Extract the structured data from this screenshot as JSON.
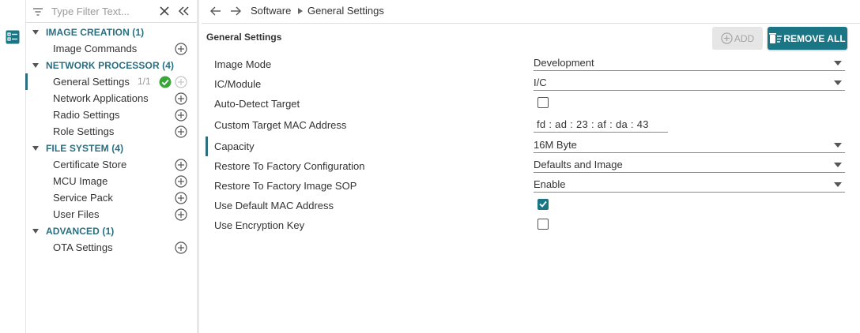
{
  "filter": {
    "placeholder": "Type Filter Text..."
  },
  "tree": {
    "categories": [
      {
        "label": "IMAGE CREATION (1)"
      },
      {
        "label": "NETWORK PROCESSOR (4)"
      },
      {
        "label": "FILE SYSTEM (4)"
      },
      {
        "label": "ADVANCED (1)"
      }
    ],
    "items": [
      {
        "label": "Image Commands"
      },
      {
        "label": "General Settings",
        "count": "1/1"
      },
      {
        "label": "Network Applications"
      },
      {
        "label": "Radio Settings"
      },
      {
        "label": "Role Settings"
      },
      {
        "label": "Certificate Store"
      },
      {
        "label": "MCU Image"
      },
      {
        "label": "Service Pack"
      },
      {
        "label": "User Files"
      },
      {
        "label": "OTA Settings"
      }
    ]
  },
  "breadcrumb": {
    "items": [
      "Software",
      "General Settings"
    ]
  },
  "main": {
    "title": "General Settings",
    "add_label": "ADD",
    "remove_all_label": "REMOVE ALL"
  },
  "properties": [
    {
      "label": "Image Mode",
      "type": "select",
      "value": "Development"
    },
    {
      "label": "IC/Module",
      "type": "select",
      "value": "I/C"
    },
    {
      "label": "Auto-Detect Target",
      "type": "checkbox",
      "checked": false
    },
    {
      "label": "Custom Target MAC Address",
      "type": "mac",
      "value": "fd : ad : 23 : af : da : 43"
    },
    {
      "label": "Capacity",
      "type": "select",
      "value": "16M Byte"
    },
    {
      "label": "Restore To Factory Configuration",
      "type": "select",
      "value": "Defaults and Image"
    },
    {
      "label": "Restore To Factory Image SOP",
      "type": "select",
      "value": "Enable"
    },
    {
      "label": "Use Default MAC Address",
      "type": "checkbox",
      "checked": true
    },
    {
      "label": "Use Encryption Key",
      "type": "checkbox",
      "checked": false
    }
  ],
  "colors": {
    "accent": "#1a7585",
    "category_text": "#2a6f80",
    "success": "#3aa63a"
  },
  "icons": {
    "activity": "settings-list-icon",
    "filter": "filter-icon",
    "clear": "close-icon",
    "collapse": "collapse-double-chevron-icon",
    "add": "plus-circle-icon",
    "check": "check-circle-icon",
    "remove_all": "trash-list-icon",
    "dropdown": "caret-down-icon"
  }
}
